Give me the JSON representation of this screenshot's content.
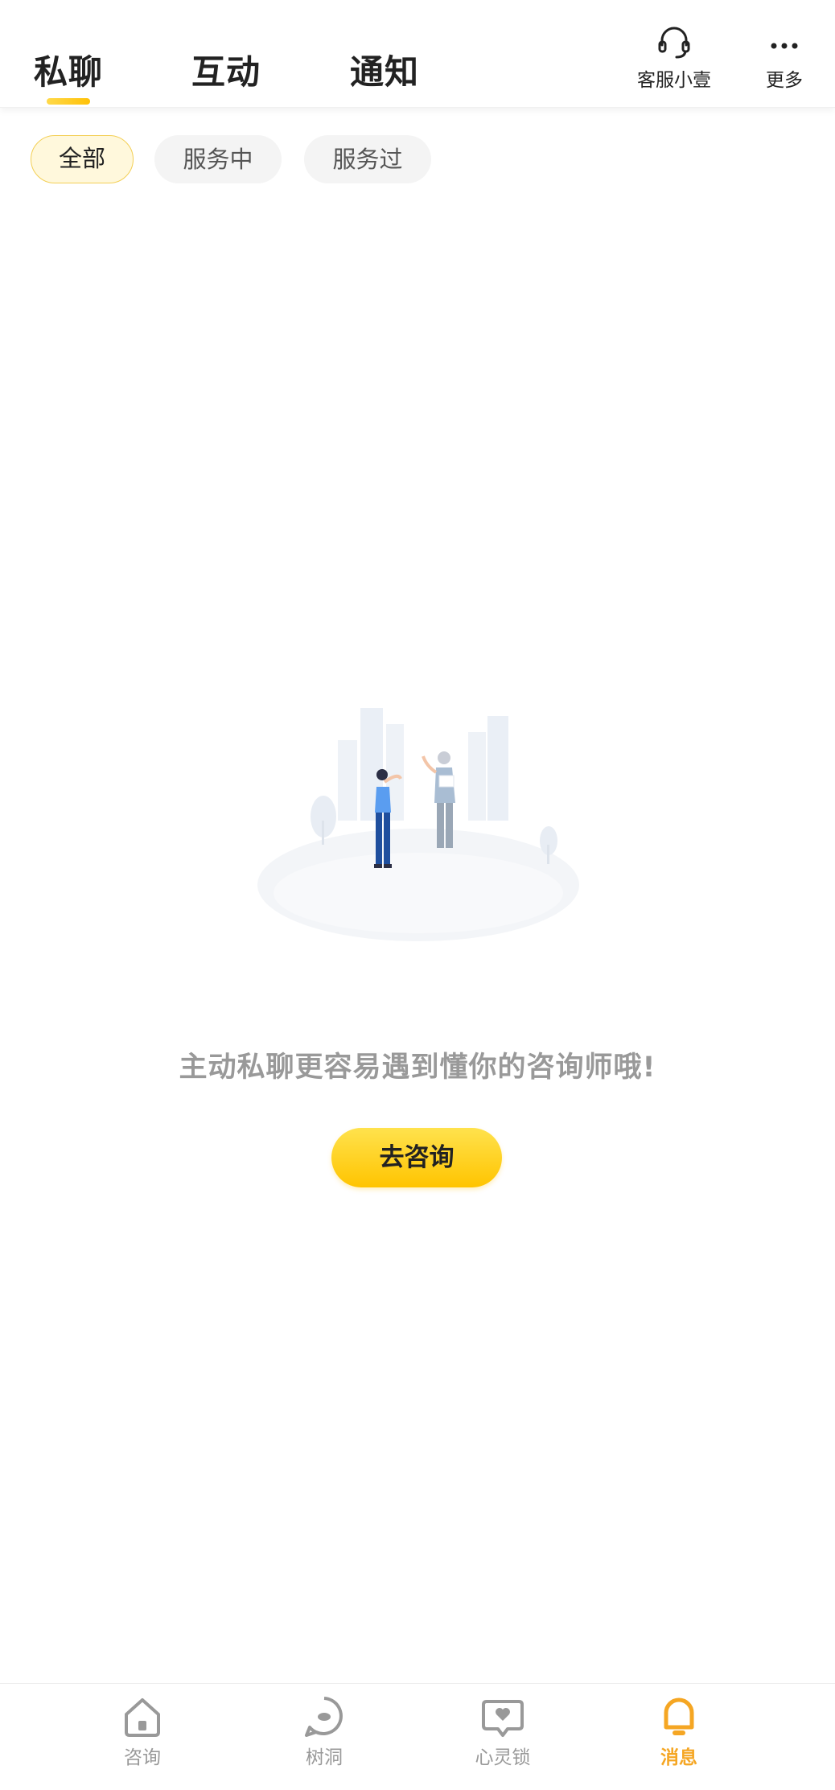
{
  "header": {
    "tabs": [
      {
        "label": "私聊",
        "active": true
      },
      {
        "label": "互动",
        "active": false
      },
      {
        "label": "通知",
        "active": false
      }
    ],
    "service_label": "客服小壹",
    "more_label": "更多",
    "accent": "#ffc107"
  },
  "filters": {
    "chips": [
      {
        "label": "全部",
        "active": true
      },
      {
        "label": "服务中",
        "active": false
      },
      {
        "label": "服务过",
        "active": false
      }
    ]
  },
  "empty_state": {
    "message": "主动私聊更容易遇到懂你的咨询师哦!",
    "cta_label": "去咨询"
  },
  "bottom_nav": {
    "items": [
      {
        "label": "咨询",
        "icon": "home-icon",
        "active": false
      },
      {
        "label": "树洞",
        "icon": "chat-bubble-icon",
        "active": false
      },
      {
        "label": "心灵锁",
        "icon": "heart-message-icon",
        "active": false
      },
      {
        "label": "消息",
        "icon": "bell-icon",
        "active": true
      }
    ],
    "active_color": "#f5a623",
    "inactive_color": "#999999"
  }
}
